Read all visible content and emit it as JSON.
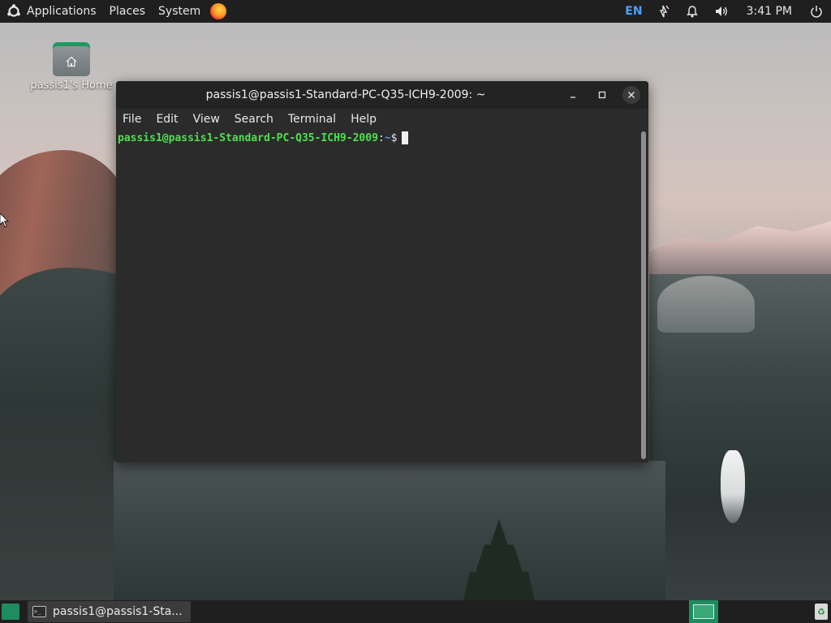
{
  "top_panel": {
    "menus": [
      "Applications",
      "Places",
      "System"
    ],
    "language": "EN",
    "clock": "3:41 PM"
  },
  "desktop": {
    "home_icon_label": "passis1's Home"
  },
  "terminal": {
    "title": "passis1@passis1-Standard-PC-Q35-ICH9-2009: ~",
    "menu": [
      "File",
      "Edit",
      "View",
      "Search",
      "Terminal",
      "Help"
    ],
    "prompt_user_host": "passis1@passis1-Standard-PC-Q35-ICH9-2009",
    "prompt_sep": ":",
    "prompt_path": "~",
    "prompt_sign": "$"
  },
  "bottom_panel": {
    "task_label": "passis1@passis1-Sta..."
  },
  "colors": {
    "panel_bg": "#1f1f1f",
    "terminal_bg": "#2b2b2b",
    "prompt_user": "#4fe04f",
    "prompt_path": "#5b8fe8",
    "accent_green": "#1e8c5e",
    "lang_blue": "#4aa3ff"
  }
}
